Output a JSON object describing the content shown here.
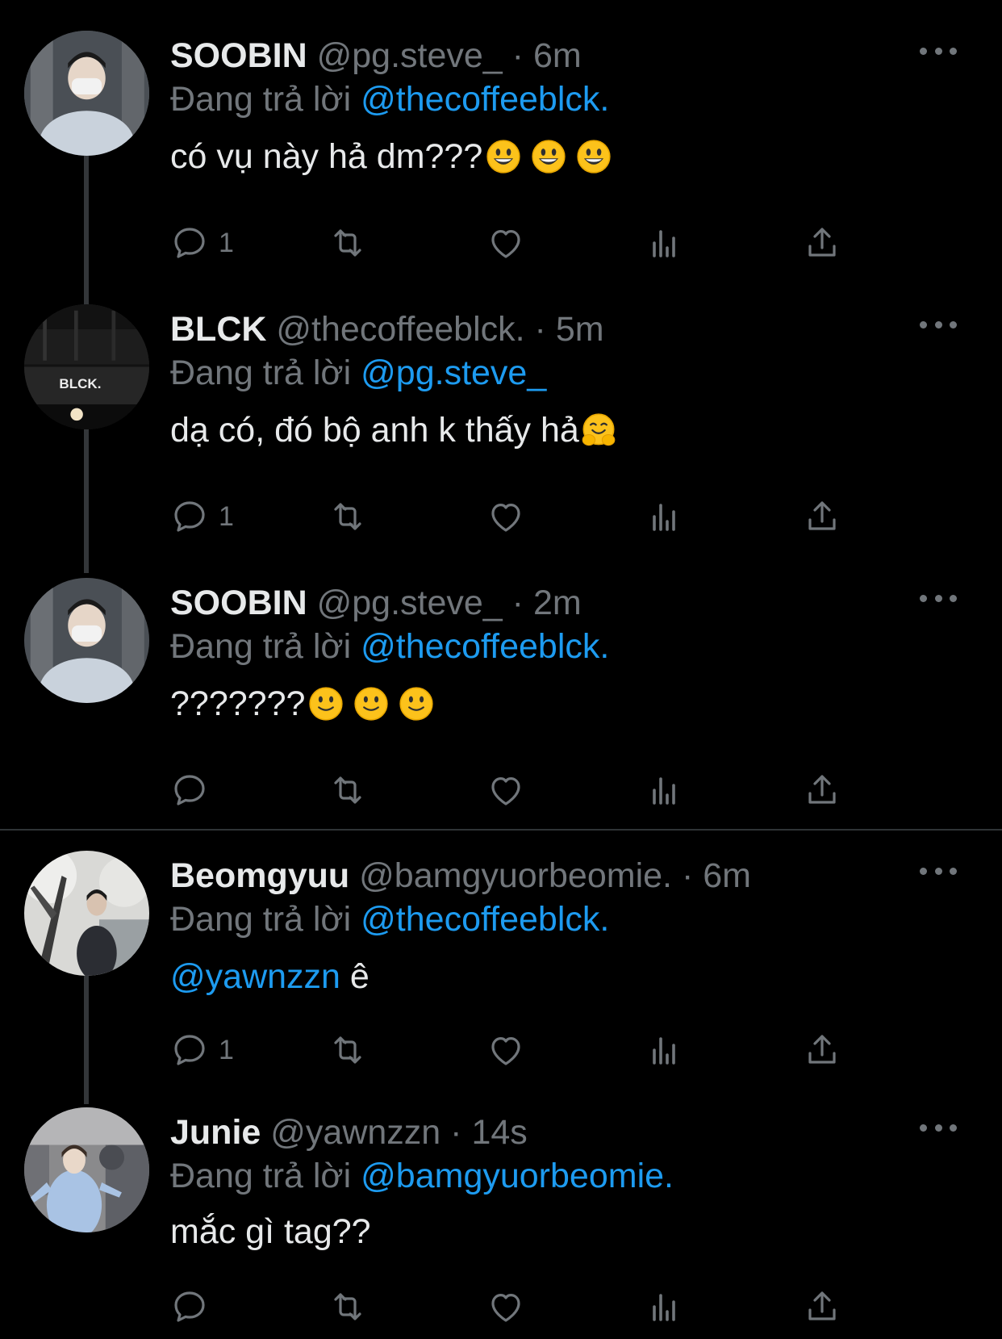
{
  "reply_prefix": "Đang trả lời",
  "colors": {
    "background": "#000000",
    "text": "#e7e9ea",
    "muted": "#71767b",
    "link": "#1d9bf0"
  },
  "tweets": [
    {
      "name": "SOOBIN",
      "handle": "@pg.steve_",
      "separator": "·",
      "time": "6m",
      "reply_to": "@thecoffeeblck.",
      "text": "có vụ này hả dm???",
      "emojis": [
        "grinning-face",
        "grinning-face",
        "grinning-face"
      ],
      "reply_count": "1"
    },
    {
      "name": "BLCK",
      "handle": "@thecoffeeblck.",
      "separator": "·",
      "time": "5m",
      "reply_to": "@pg.steve_",
      "text": "dạ có, đó bộ anh k thấy hả",
      "emojis": [
        "hugging-face"
      ],
      "reply_count": "1",
      "avatar_sign": "BLCK."
    },
    {
      "name": "SOOBIN",
      "handle": "@pg.steve_",
      "separator": "·",
      "time": "2m",
      "reply_to": "@thecoffeeblck.",
      "text": "???????",
      "emojis": [
        "slightly-smiling-face",
        "slightly-smiling-face",
        "slightly-smiling-face"
      ],
      "reply_count": ""
    },
    {
      "name": "Beomgyuu",
      "handle": "@bamgyuorbeomie.",
      "separator": "·",
      "time": "6m",
      "reply_to": "@thecoffeeblck.",
      "text_mention": "@yawnzzn",
      "text": " ê",
      "reply_count": "1"
    },
    {
      "name": "Junie",
      "handle": "@yawnzzn",
      "separator": "·",
      "time": "14s",
      "reply_to": "@bamgyuorbeomie.",
      "text": "mắc gì tag??",
      "reply_count": ""
    }
  ]
}
